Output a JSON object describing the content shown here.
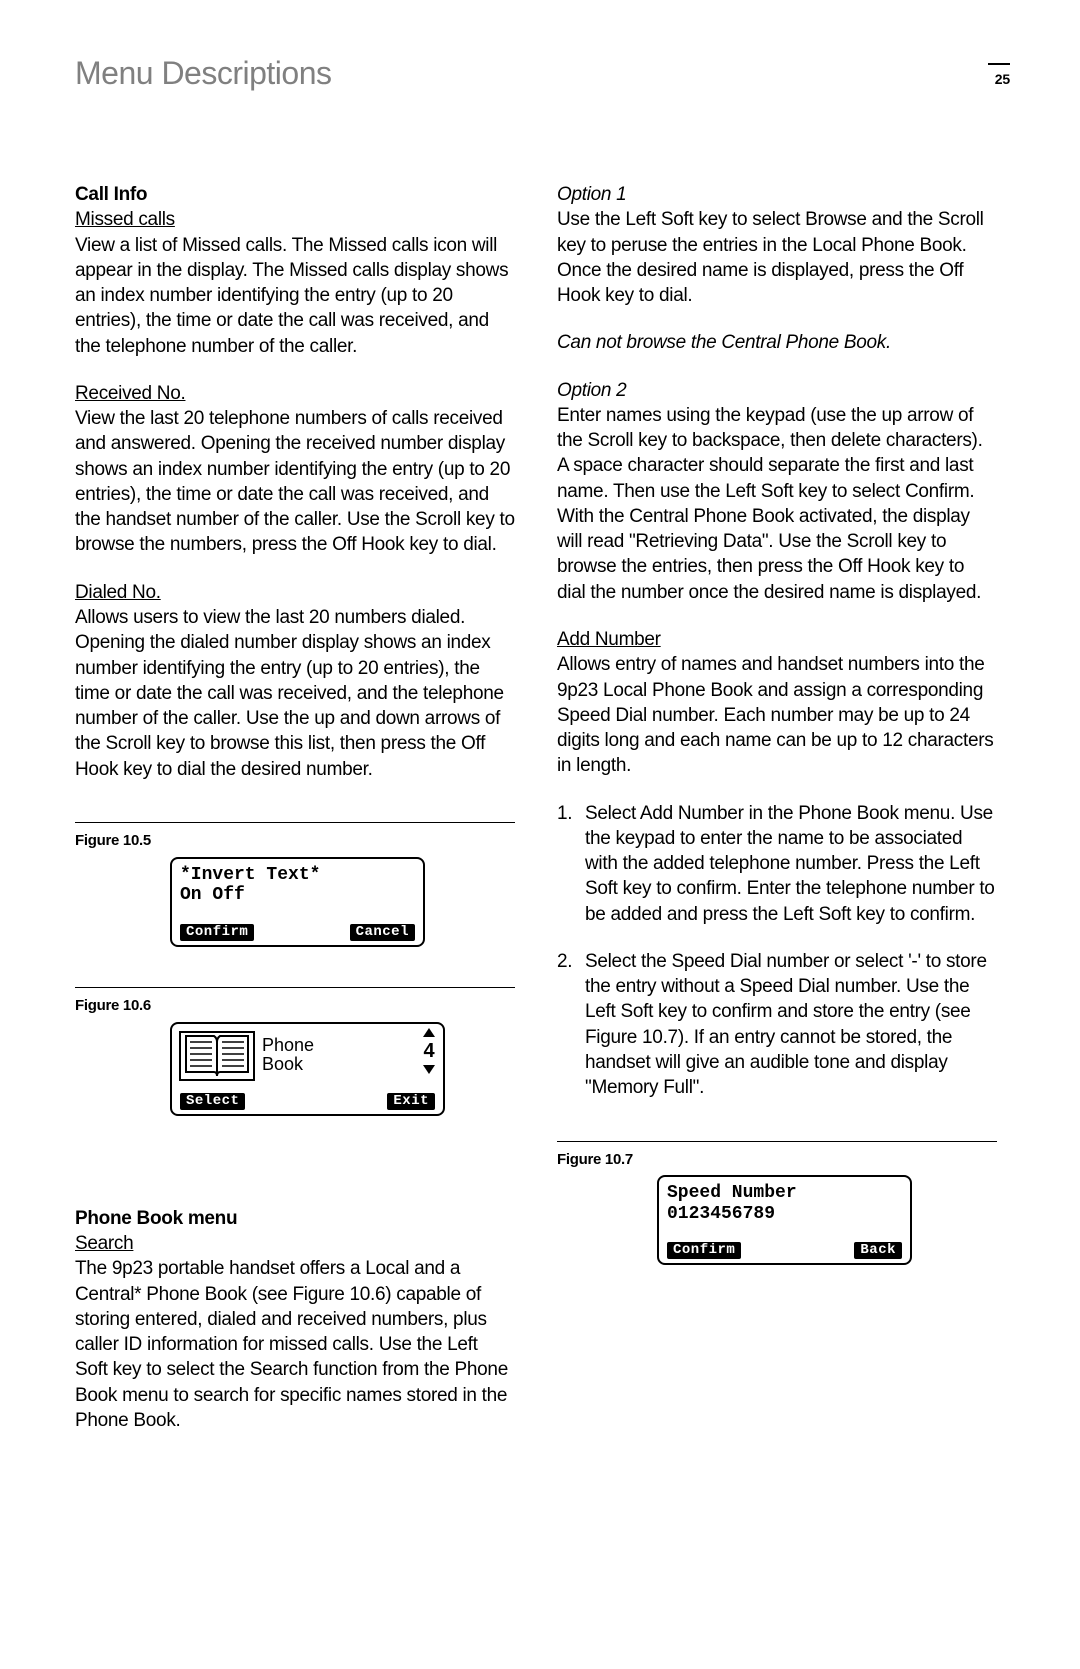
{
  "header": {
    "title": "Menu Descriptions",
    "page_number": "25"
  },
  "left_column": {
    "call_info_heading": "Call Info",
    "missed_calls_heading": "Missed calls",
    "missed_calls_body": "View a list of Missed calls. The Missed calls icon will appear in the display. The Missed calls display shows an index number identifying the entry (up to 20 entries), the time or date the call was received, and the telephone number of the caller.",
    "received_no_heading": "Received No.",
    "received_no_body": "View the last 20 telephone numbers of calls received and answered. Opening the received number display shows an index number identifying the entry (up to 20 entries), the time or date the call was received, and the handset number of the caller. Use the Scroll key to browse the numbers, press the Off Hook key to dial.",
    "dialed_no_heading": "Dialed No.",
    "dialed_no_body": "Allows users to view the last 20 numbers dialed. Opening the dialed number display shows an index number identifying the entry (up to 20 entries), the time or date the call was received, and the telephone number of the caller. Use the up and down arrows of the Scroll key to browse this list, then press the Off Hook key to dial the desired number.",
    "figure_10_5_label": "Figure 10.5",
    "figure_10_5": {
      "line1": "*Invert Text*",
      "line2": "On Off",
      "btn_left": "Confirm",
      "btn_right": "Cancel"
    },
    "figure_10_6_label": "Figure 10.6",
    "figure_10_6": {
      "label_line1": "Phone",
      "label_line2": "Book",
      "count": "4",
      "btn_left": "Select",
      "btn_right": "Exit"
    },
    "phone_book_menu_heading": "Phone Book menu",
    "search_heading": "Search",
    "search_body": "The 9p23 portable handset offers a Local and a Central* Phone Book (see Figure 10.6) capable of storing entered, dialed and received numbers, plus caller ID information for missed calls. Use the Left Soft key to select the Search function from the Phone Book menu to search for specific names stored in the Phone Book."
  },
  "right_column": {
    "option1_heading": "Option 1",
    "option1_body": "Use the Left Soft key to select Browse and the Scroll key to peruse the entries in the Local Phone Book. Once the desired name is displayed, press the Off Hook key to dial.",
    "cannot_browse": "Can not browse the Central Phone Book.",
    "option2_heading": "Option 2",
    "option2_body": "Enter names using the keypad (use the up arrow of the Scroll key to backspace, then delete characters). A space character should separate the first and last name. Then use the Left Soft key to select Confirm. With the Central Phone Book activated, the display will read \"Retrieving Data\". Use the Scroll key to browse the entries, then press the Off Hook key to dial the number once the desired name is displayed.",
    "add_number_heading": "Add Number",
    "add_number_body": "Allows entry of names and handset numbers into the 9p23 Local Phone Book and assign a corresponding Speed Dial number. Each number may be up to 24 digits long and each name can be up to 12 characters in length.",
    "list_item_1": "Select Add Number in the Phone Book menu. Use the keypad to enter the name to be associated with the added telephone number. Press the Left Soft key to confirm. Enter the telephone number to be added and press the Left Soft key to confirm.",
    "list_item_2": "Select the Speed Dial number or select '-' to store the entry without a Speed Dial number. Use the Left Soft key to confirm and store the entry (see Figure 10.7). If an entry cannot be stored, the handset will give an audible tone and display \"Memory Full\".",
    "figure_10_7_label": "Figure 10.7",
    "figure_10_7": {
      "line1": "Speed Number",
      "line2": "0123456789",
      "btn_left": "Confirm",
      "btn_right": "Back"
    }
  }
}
